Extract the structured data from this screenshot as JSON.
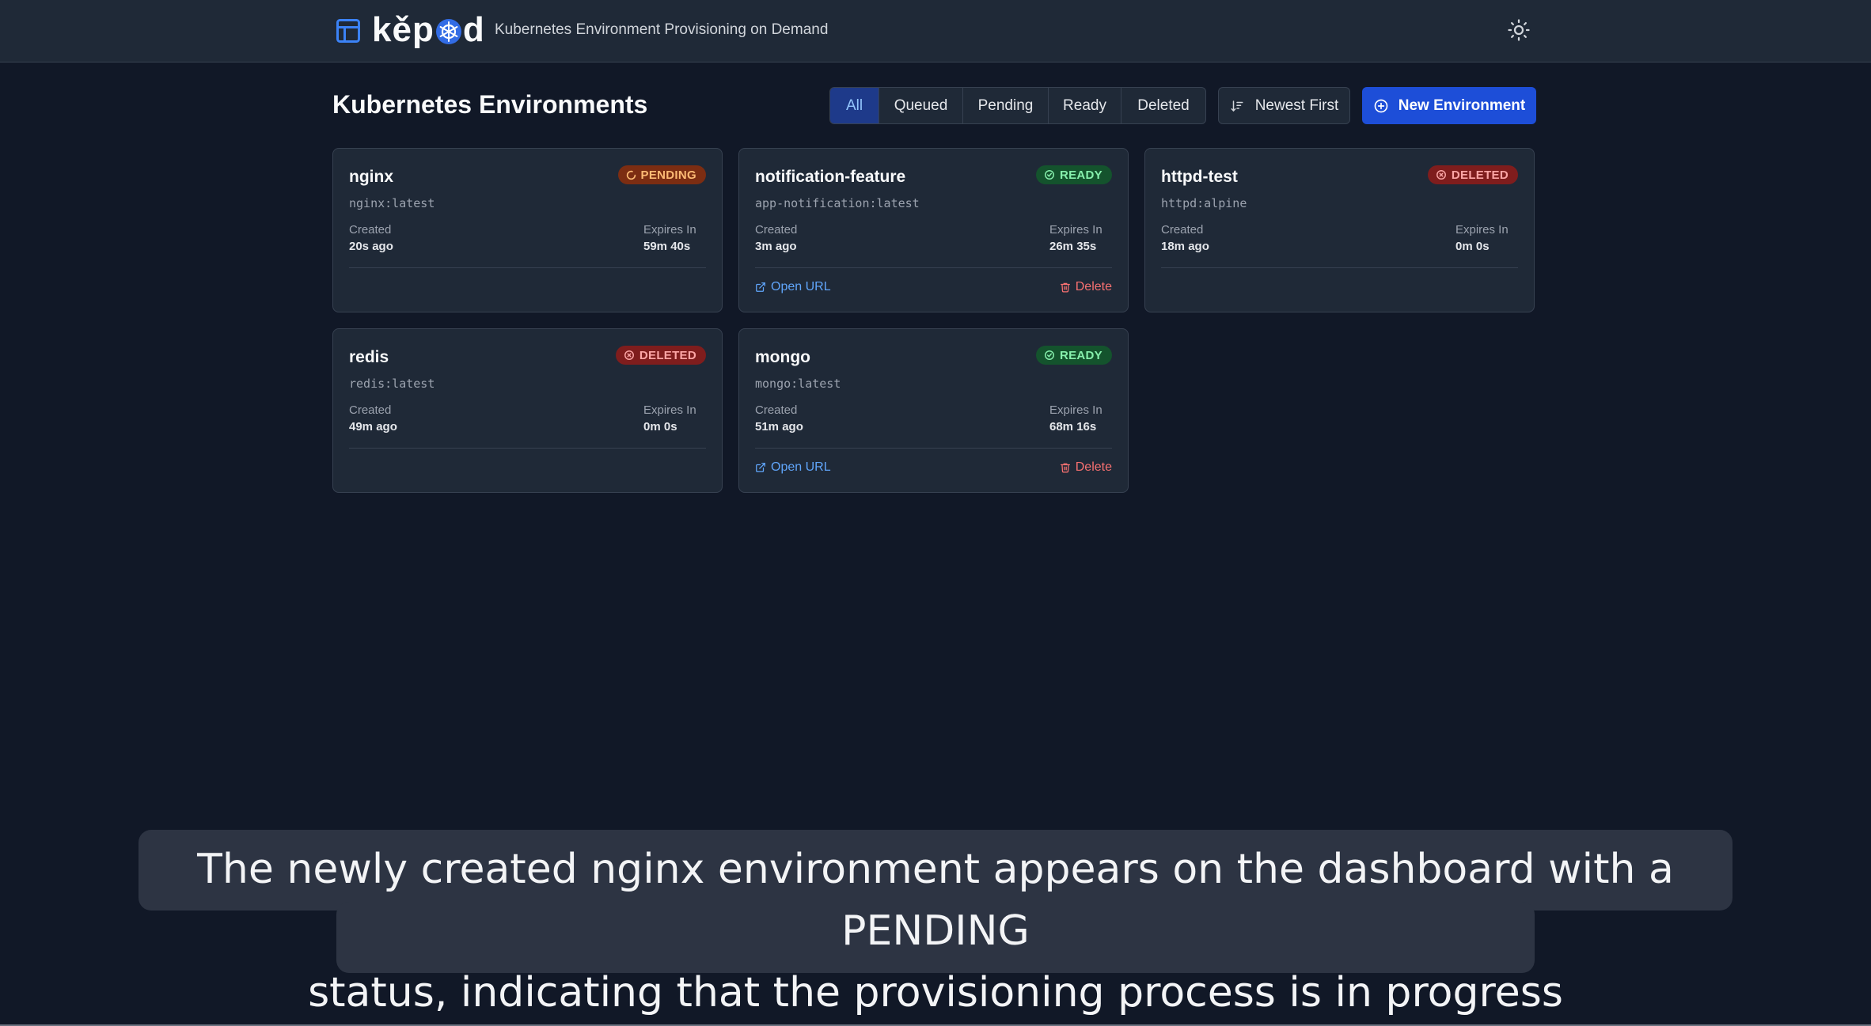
{
  "header": {
    "logo_prefix": "kěp",
    "logo_suffix": "d",
    "tagline": "Kubernetes Environment Provisioning on Demand"
  },
  "main": {
    "title": "Kubernetes Environments",
    "filters": [
      "All",
      "Queued",
      "Pending",
      "Ready",
      "Deleted"
    ],
    "active_filter": "All",
    "sort_label": "Newest First",
    "new_button_label": "New Environment"
  },
  "labels": {
    "created": "Created",
    "expires_in": "Expires In",
    "open_url": "Open URL",
    "delete": "Delete"
  },
  "environments": [
    {
      "name": "nginx",
      "image": "nginx:latest",
      "status": "PENDING",
      "created": "20s ago",
      "expires": "59m 40s"
    },
    {
      "name": "notification-feature",
      "image": "app-notification:latest",
      "status": "READY",
      "created": "3m ago",
      "expires": "26m 35s"
    },
    {
      "name": "httpd-test",
      "image": "httpd:alpine",
      "status": "DELETED",
      "created": "18m ago",
      "expires": "0m 0s"
    },
    {
      "name": "redis",
      "image": "redis:latest",
      "status": "DELETED",
      "created": "49m ago",
      "expires": "0m 0s"
    },
    {
      "name": "mongo",
      "image": "mongo:latest",
      "status": "READY",
      "created": "51m ago",
      "expires": "68m 16s"
    }
  ],
  "caption": {
    "line1": "The newly created nginx environment appears on the dashboard with a PENDING",
    "line2": "status, indicating that the provisioning process is in progress"
  },
  "colors": {
    "background": "#111827",
    "header": "#1f2937",
    "primary": "#1d4ed8",
    "pending": "#fdba74",
    "ready": "#86efac",
    "deleted": "#fca5a5",
    "link": "#60a5fa"
  }
}
